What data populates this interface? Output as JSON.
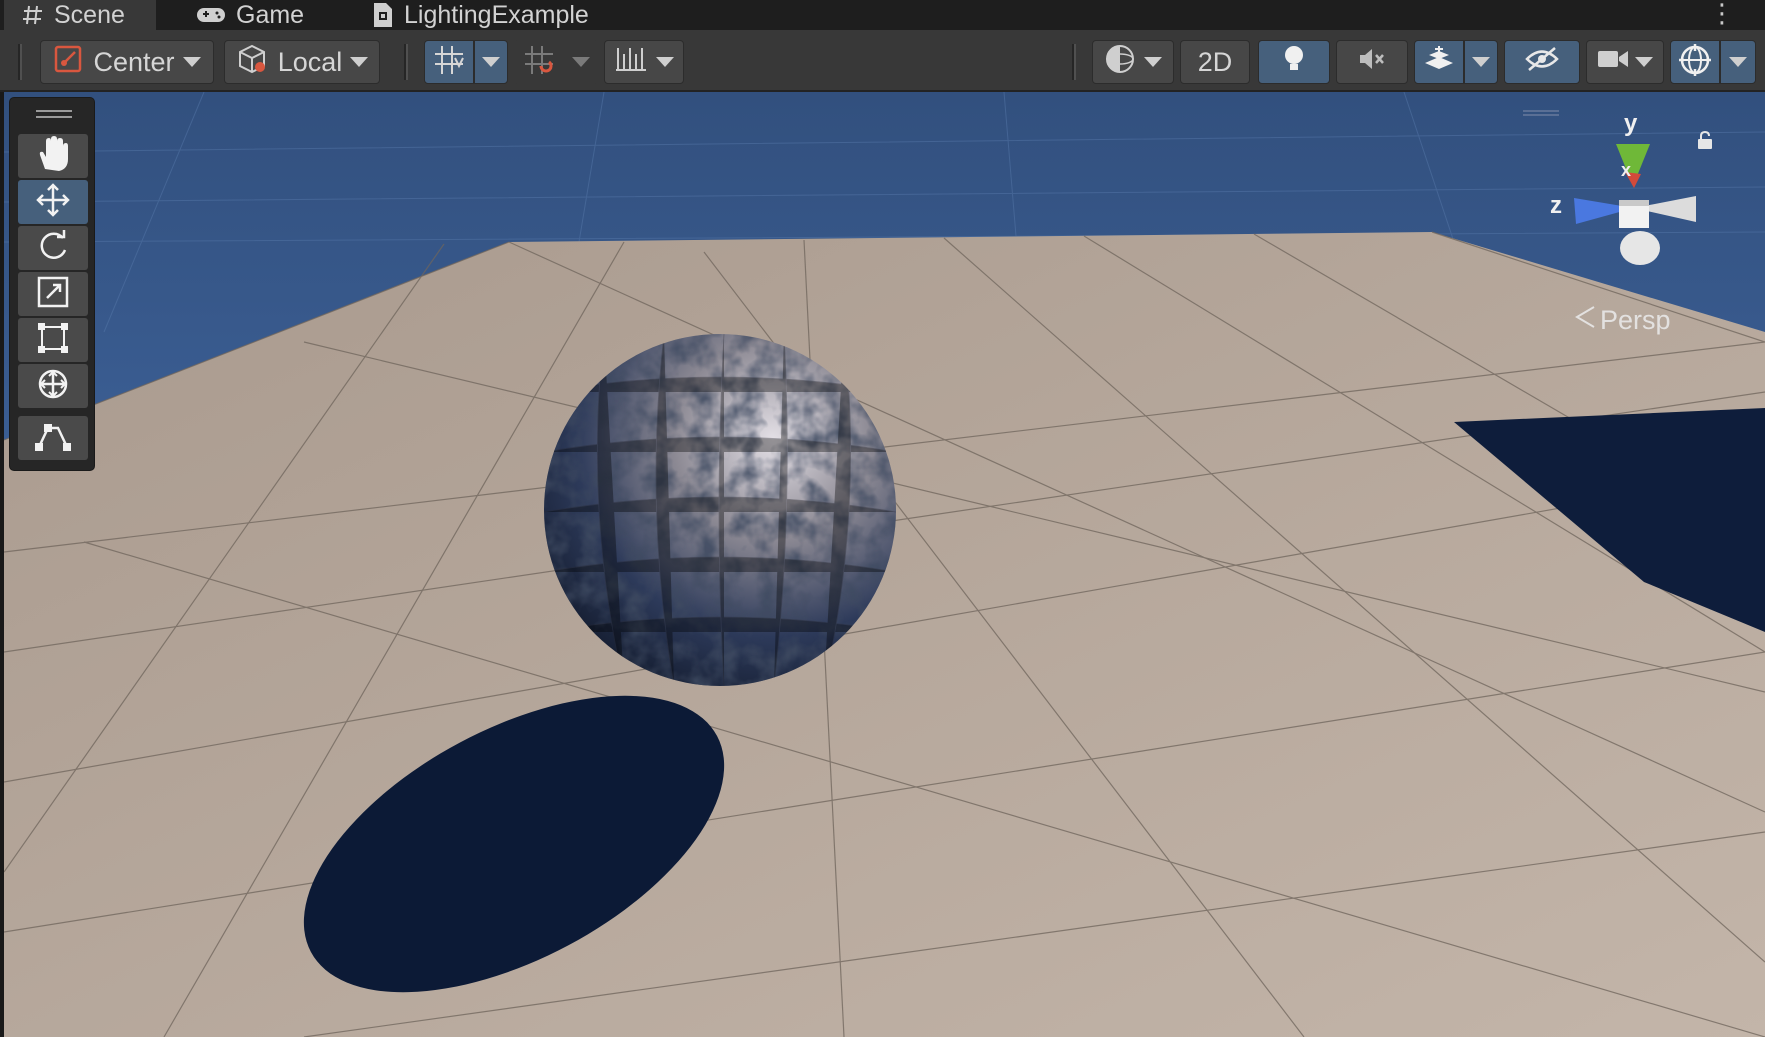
{
  "tabs": [
    {
      "label": "Scene",
      "icon": "hash-icon",
      "active": true
    },
    {
      "label": "Game",
      "icon": "gamepad-icon",
      "active": false
    },
    {
      "label": "LightingExample",
      "icon": "scene-file-icon",
      "active": false
    }
  ],
  "toolbar": {
    "pivot_mode": "Center",
    "pivot_rotation": "Local",
    "mode_2d": "2D"
  },
  "tools": [
    {
      "name": "hand-tool",
      "icon": "hand-icon",
      "active": false
    },
    {
      "name": "move-tool",
      "icon": "move-icon",
      "active": true
    },
    {
      "name": "rotate-tool",
      "icon": "rotate-icon",
      "active": false
    },
    {
      "name": "scale-tool",
      "icon": "scale-icon",
      "active": false
    },
    {
      "name": "rect-tool",
      "icon": "rect-icon",
      "active": false
    },
    {
      "name": "transform-tool",
      "icon": "transform-icon",
      "active": false
    },
    {
      "name": "custom-editor-tool",
      "icon": "path-icon",
      "active": false
    }
  ],
  "gizmo": {
    "y_label": "y",
    "z_label": "z",
    "x_label": "x",
    "projection": "Persp"
  },
  "colors": {
    "sky": "#3f6290",
    "ground": "#a8998d",
    "shadow": "#0d1b38",
    "accent_selected": "#46607c",
    "axis_y": "#7ecb3f",
    "axis_z": "#4a78e0",
    "axis_x": "#d34a3a"
  }
}
